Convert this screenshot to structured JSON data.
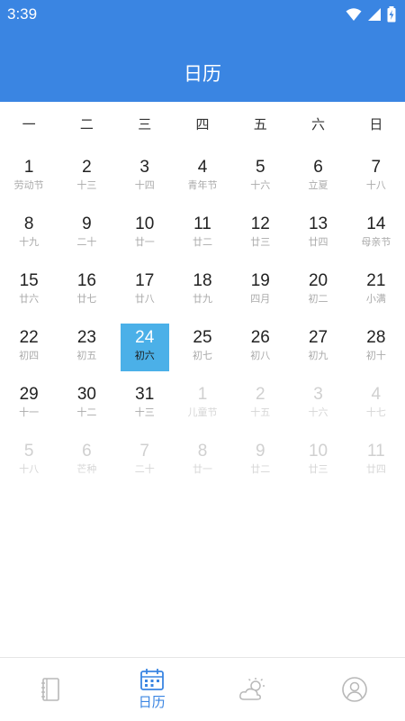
{
  "status": {
    "time": "3:39"
  },
  "header": {
    "title": "日历"
  },
  "weekdays": [
    "一",
    "二",
    "三",
    "四",
    "五",
    "六",
    "日"
  ],
  "weeks": [
    [
      {
        "num": "1",
        "sub": "劳动节",
        "other": false,
        "today": false
      },
      {
        "num": "2",
        "sub": "十三",
        "other": false,
        "today": false
      },
      {
        "num": "3",
        "sub": "十四",
        "other": false,
        "today": false
      },
      {
        "num": "4",
        "sub": "青年节",
        "other": false,
        "today": false
      },
      {
        "num": "5",
        "sub": "十六",
        "other": false,
        "today": false
      },
      {
        "num": "6",
        "sub": "立夏",
        "other": false,
        "today": false
      },
      {
        "num": "7",
        "sub": "十八",
        "other": false,
        "today": false
      }
    ],
    [
      {
        "num": "8",
        "sub": "十九",
        "other": false,
        "today": false
      },
      {
        "num": "9",
        "sub": "二十",
        "other": false,
        "today": false
      },
      {
        "num": "10",
        "sub": "廿一",
        "other": false,
        "today": false
      },
      {
        "num": "11",
        "sub": "廿二",
        "other": false,
        "today": false
      },
      {
        "num": "12",
        "sub": "廿三",
        "other": false,
        "today": false
      },
      {
        "num": "13",
        "sub": "廿四",
        "other": false,
        "today": false
      },
      {
        "num": "14",
        "sub": "母亲节",
        "other": false,
        "today": false
      }
    ],
    [
      {
        "num": "15",
        "sub": "廿六",
        "other": false,
        "today": false
      },
      {
        "num": "16",
        "sub": "廿七",
        "other": false,
        "today": false
      },
      {
        "num": "17",
        "sub": "廿八",
        "other": false,
        "today": false
      },
      {
        "num": "18",
        "sub": "廿九",
        "other": false,
        "today": false
      },
      {
        "num": "19",
        "sub": "四月",
        "other": false,
        "today": false
      },
      {
        "num": "20",
        "sub": "初二",
        "other": false,
        "today": false
      },
      {
        "num": "21",
        "sub": "小满",
        "other": false,
        "today": false
      }
    ],
    [
      {
        "num": "22",
        "sub": "初四",
        "other": false,
        "today": false
      },
      {
        "num": "23",
        "sub": "初五",
        "other": false,
        "today": false
      },
      {
        "num": "24",
        "sub": "初六",
        "other": false,
        "today": true
      },
      {
        "num": "25",
        "sub": "初七",
        "other": false,
        "today": false
      },
      {
        "num": "26",
        "sub": "初八",
        "other": false,
        "today": false
      },
      {
        "num": "27",
        "sub": "初九",
        "other": false,
        "today": false
      },
      {
        "num": "28",
        "sub": "初十",
        "other": false,
        "today": false
      }
    ],
    [
      {
        "num": "29",
        "sub": "十一",
        "other": false,
        "today": false
      },
      {
        "num": "30",
        "sub": "十二",
        "other": false,
        "today": false
      },
      {
        "num": "31",
        "sub": "十三",
        "other": false,
        "today": false
      },
      {
        "num": "1",
        "sub": "儿童节",
        "other": true,
        "today": false
      },
      {
        "num": "2",
        "sub": "十五",
        "other": true,
        "today": false
      },
      {
        "num": "3",
        "sub": "十六",
        "other": true,
        "today": false
      },
      {
        "num": "4",
        "sub": "十七",
        "other": true,
        "today": false
      }
    ],
    [
      {
        "num": "5",
        "sub": "十八",
        "other": true,
        "today": false
      },
      {
        "num": "6",
        "sub": "芒种",
        "other": true,
        "today": false
      },
      {
        "num": "7",
        "sub": "二十",
        "other": true,
        "today": false
      },
      {
        "num": "8",
        "sub": "廿一",
        "other": true,
        "today": false
      },
      {
        "num": "9",
        "sub": "廿二",
        "other": true,
        "today": false
      },
      {
        "num": "10",
        "sub": "廿三",
        "other": true,
        "today": false
      },
      {
        "num": "11",
        "sub": "廿四",
        "other": true,
        "today": false
      }
    ]
  ],
  "bottom_nav": {
    "items": [
      {
        "icon": "notebook-icon",
        "label": ""
      },
      {
        "icon": "calendar-icon",
        "label": "日历"
      },
      {
        "icon": "weather-icon",
        "label": ""
      },
      {
        "icon": "profile-icon",
        "label": ""
      }
    ]
  },
  "colors": {
    "accent": "#3a85e2",
    "today_bg": "#4bb0e8",
    "other_month_text": "#d0d0d0"
  }
}
